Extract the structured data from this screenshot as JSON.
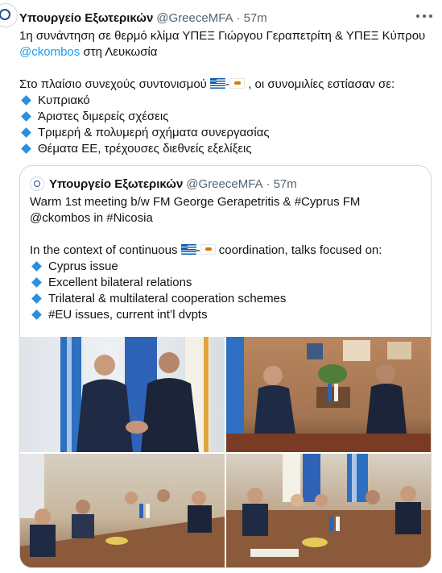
{
  "tweet": {
    "author_name": "Υπουργείο Εξωτερικών",
    "handle": "@GreeceMFA",
    "separator": "·",
    "time": "57m",
    "line1": "1η συνάντηση σε θερμό κλίμα ΥΠΕΞ Γιώργου Γεραπετρίτη & ΥΠΕΞ Κύπρου",
    "mention": "@ckombos",
    "line2_rest": " στη Λευκωσία",
    "line3_prefix": "Στο πλαίσιο συνεχούς συντονισμού ",
    "line3_dash": "-",
    "line3_suffix": " , οι συνομιλίες εστίασαν σε:",
    "bullets": [
      "Κυπριακό",
      "Άριστες διμερείς σχέσεις",
      "Τριμερή & πολυμερή σχήματα συνεργασίας",
      "Θέματα ΕΕ, τρέχουσες διεθνείς εξελίξεις"
    ]
  },
  "quoted": {
    "author_name": "Υπουργείο Εξωτερικών",
    "handle": "@GreeceMFA",
    "separator": "·",
    "time": "57m",
    "line1": "Warm 1st meeting b/w FM George Gerapetritis & #Cyprus FM",
    "line2": "@ckombos in #Nicosia",
    "line3_prefix": "In the context of continuous ",
    "line3_dash": "-",
    "line3_suffix": " coordination, talks focused on:",
    "bullets": [
      "Cyprus issue",
      "Excellent bilateral relations",
      "Trilateral & multilateral cooperation schemes",
      "#EU issues, current int’l dvpts"
    ]
  },
  "icons": {
    "more": "more-horizontal-icon",
    "bullet": "small-blue-diamond-icon",
    "flag_greece": "greece-flag-icon",
    "flag_cyprus": "cyprus-flag-icon"
  },
  "colors": {
    "link": "#1d9bf0",
    "secondary_text": "#536471",
    "border": "#cfd9de",
    "diamond": "#2a8fe0"
  }
}
